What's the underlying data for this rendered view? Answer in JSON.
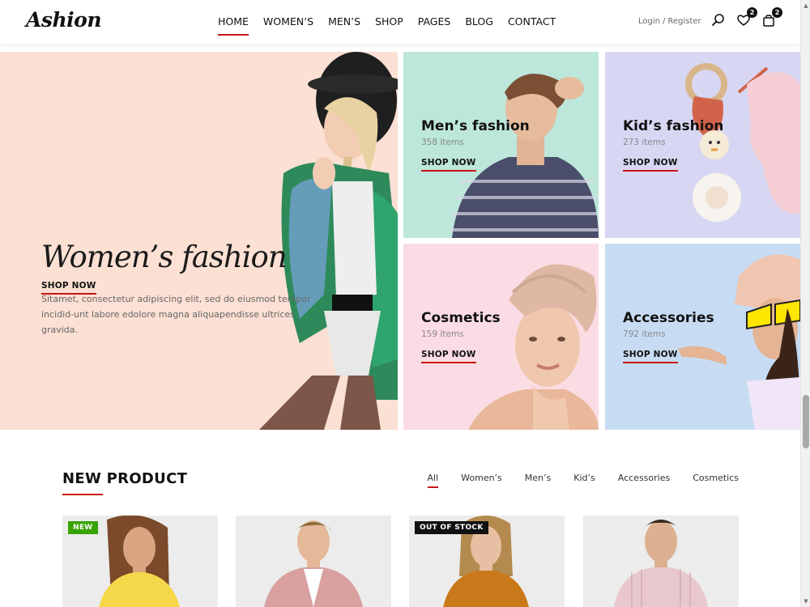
{
  "header": {
    "logo": "Ashion",
    "nav": [
      {
        "label": "HOME",
        "active": true
      },
      {
        "label": "WOMEN’S",
        "active": false
      },
      {
        "label": "MEN’S",
        "active": false
      },
      {
        "label": "SHOP",
        "active": false
      },
      {
        "label": "PAGES",
        "active": false
      },
      {
        "label": "BLOG",
        "active": false
      },
      {
        "label": "CONTACT",
        "active": false
      }
    ],
    "login_label": "Login",
    "separator": "/",
    "register_label": "Register",
    "icons": [
      "search-icon",
      "heart-icon",
      "bag-icon"
    ],
    "wishlist_count": "2",
    "cart_count": "2"
  },
  "hero": {
    "title": "Women’s fashion",
    "description": "Sitamet, consectetur adipiscing elit, sed do eiusmod tempor incidid-unt labore edolore magna aliquapendisse ultrices gravida.",
    "cta": "SHOP NOW"
  },
  "categories": [
    {
      "name": "Men’s fashion",
      "count": "358 items",
      "cta": "SHOP NOW"
    },
    {
      "name": "Kid’s fashion",
      "count": "273 items",
      "cta": "SHOP NOW"
    },
    {
      "name": "Cosmetics",
      "count": "159 items",
      "cta": "SHOP NOW"
    },
    {
      "name": "Accessories",
      "count": "792 items",
      "cta": "SHOP NOW"
    }
  ],
  "new_product": {
    "title": "NEW PRODUCT",
    "filters": [
      "All",
      "Women’s",
      "Men’s",
      "Kid’s",
      "Accessories",
      "Cosmetics"
    ],
    "active_filter": "All",
    "products": [
      {
        "badge": "NEW",
        "shirt_color": "#f5d84a",
        "skin": "#d9a47f",
        "hair": "#7a4a2a"
      },
      {
        "badge": "",
        "shirt_color": "#d9a0a0",
        "skin": "#e4b898",
        "hair": "#8a6a3a"
      },
      {
        "badge": "OUT OF STOCK",
        "shirt_color": "#c9791a",
        "skin": "#e7c0a3",
        "hair": "#b58a4e"
      },
      {
        "badge": "",
        "shirt_color": "#e8c8cc",
        "skin": "#dcb091",
        "hair": "#3a2a20"
      }
    ]
  },
  "colors": {
    "accent": "#ca1515",
    "hero_bg": "#fbe0d3",
    "men_bg": "#bde7db",
    "kid_bg": "#d8d7f3",
    "cosmetics_bg": "#fbdce4",
    "accessories_bg": "#c7dcf3",
    "new_badge": "#36a300"
  }
}
